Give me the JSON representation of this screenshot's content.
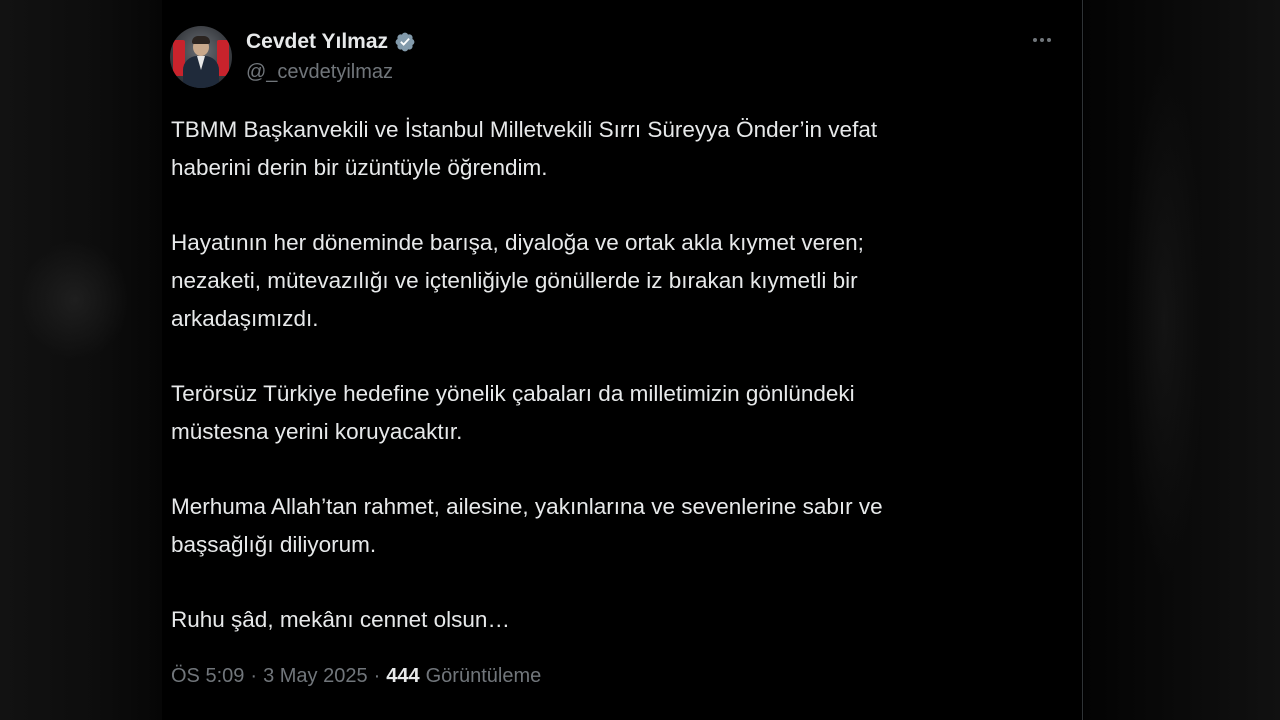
{
  "author": {
    "display_name": "Cevdet Yılmaz",
    "handle": "@_cevdetyilmaz",
    "verified": true,
    "verified_color": "#829aab"
  },
  "tweet": {
    "paragraphs": [
      "TBMM Başkanvekili ve İstanbul Milletvekili Sırrı Süreyya Önder’in vefat\nhaberini derin bir üzüntüyle öğrendim.",
      "Hayatının her döneminde barışa, diyaloğa ve ortak akla kıymet veren;\nnezaketi, mütevazılığı ve içtenliğiyle gönüllerde iz bırakan kıymetli bir\narkadaşımızdı.",
      "Terörsüz Türkiye hedefine yönelik çabaları da milletimizin gönlündeki\nmüstesna yerini koruyacaktır.",
      "Merhuma Allah’tan rahmet, ailesine, yakınlarına ve sevenlerine sabır ve\nbaşsağlığı diliyorum.",
      "Ruhu şâd, mekânı cennet olsun…"
    ],
    "time": "ÖS 5:09",
    "separator": "·",
    "date": "3 May 2025",
    "views_count": "444",
    "views_label": "Görüntüleme"
  },
  "icons": {
    "more": "more-horizontal-icon",
    "verified": "verified-badge-icon"
  }
}
